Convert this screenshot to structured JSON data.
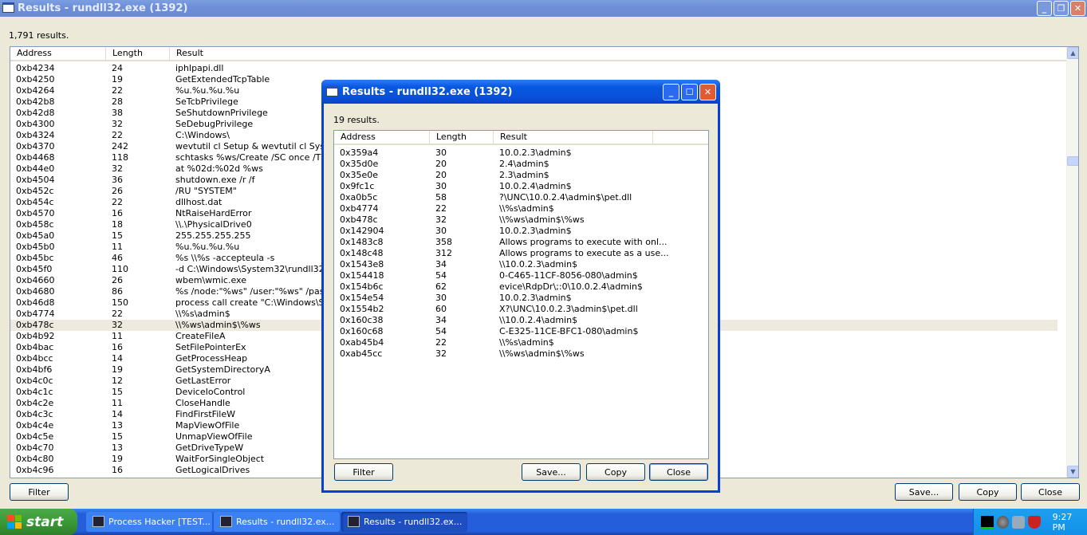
{
  "main": {
    "title": "Results - rundll32.exe (1392)",
    "count": "1,791 results.",
    "columns": [
      "Address",
      "Length",
      "Result"
    ],
    "rows": [
      [
        "0xb4234",
        "24",
        "iphlpapi.dll"
      ],
      [
        "0xb4250",
        "19",
        "GetExtendedTcpTable"
      ],
      [
        "0xb4264",
        "22",
        "%u.%u.%u.%u"
      ],
      [
        "0xb42b8",
        "28",
        "SeTcbPrivilege"
      ],
      [
        "0xb42d8",
        "38",
        "SeShutdownPrivilege"
      ],
      [
        "0xb4300",
        "32",
        "SeDebugPrivilege"
      ],
      [
        "0xb4324",
        "22",
        "C:\\Windows\\"
      ],
      [
        "0xb4370",
        "242",
        "wevtutil cl Setup & wevtutil cl System &"
      ],
      [
        "0xb4468",
        "118",
        "schtasks %ws/Create /SC once /TN \"\""
      ],
      [
        "0xb44e0",
        "32",
        "at %02d:%02d %ws"
      ],
      [
        "0xb4504",
        "36",
        "shutdown.exe /r /f"
      ],
      [
        "0xb452c",
        "26",
        "/RU \"SYSTEM\""
      ],
      [
        "0xb454c",
        "22",
        "dllhost.dat"
      ],
      [
        "0xb4570",
        "16",
        "NtRaiseHardError"
      ],
      [
        "0xb458c",
        "18",
        "\\\\.\\PhysicalDrive0"
      ],
      [
        "0xb45a0",
        "15",
        "255.255.255.255"
      ],
      [
        "0xb45b0",
        "11",
        "%u.%u.%u.%u"
      ],
      [
        "0xb45bc",
        "46",
        "%s \\\\%s -accepteula -s"
      ],
      [
        "0xb45f0",
        "110",
        "-d C:\\Windows\\System32\\rundll32.exe"
      ],
      [
        "0xb4660",
        "26",
        "wbem\\wmic.exe"
      ],
      [
        "0xb4680",
        "86",
        "%s /node:\"%ws\" /user:\"%ws\" /passw"
      ],
      [
        "0xb46d8",
        "150",
        "process call create \"C:\\Windows\\Syste"
      ],
      [
        "0xb4774",
        "22",
        "\\\\%s\\admin$"
      ],
      [
        "0xb478c",
        "32",
        "\\\\%ws\\admin$\\%ws"
      ],
      [
        "0xb4b92",
        "11",
        "CreateFileA"
      ],
      [
        "0xb4bac",
        "16",
        "SetFilePointerEx"
      ],
      [
        "0xb4bcc",
        "14",
        "GetProcessHeap"
      ],
      [
        "0xb4bf6",
        "19",
        "GetSystemDirectoryA"
      ],
      [
        "0xb4c0c",
        "12",
        "GetLastError"
      ],
      [
        "0xb4c1c",
        "15",
        "DeviceIoControl"
      ],
      [
        "0xb4c2e",
        "11",
        "CloseHandle"
      ],
      [
        "0xb4c3c",
        "14",
        "FindFirstFileW"
      ],
      [
        "0xb4c4e",
        "13",
        "MapViewOfFile"
      ],
      [
        "0xb4c5e",
        "15",
        "UnmapViewOfFile"
      ],
      [
        "0xb4c70",
        "13",
        "GetDriveTypeW"
      ],
      [
        "0xb4c80",
        "19",
        "WaitForSingleObject"
      ],
      [
        "0xb4c96",
        "16",
        "GetLogicalDrives"
      ]
    ],
    "selected_row": 23,
    "buttons": {
      "filter": "Filter",
      "save": "Save...",
      "copy": "Copy",
      "close": "Close"
    }
  },
  "dialog": {
    "title": "Results - rundll32.exe (1392)",
    "count": "19 results.",
    "columns": [
      "Address",
      "Length",
      "Result"
    ],
    "rows": [
      [
        "0x359a4",
        "30",
        "10.0.2.3\\admin$"
      ],
      [
        "0x35d0e",
        "20",
        "2.4\\admin$"
      ],
      [
        "0x35e0e",
        "20",
        "2.3\\admin$"
      ],
      [
        "0x9fc1c",
        "30",
        "10.0.2.4\\admin$"
      ],
      [
        "0xa0b5c",
        "58",
        "?\\UNC\\10.0.2.4\\admin$\\pet.dll"
      ],
      [
        "0xb4774",
        "22",
        "\\\\%s\\admin$"
      ],
      [
        "0xb478c",
        "32",
        "\\\\%ws\\admin$\\%ws"
      ],
      [
        "0x142904",
        "30",
        "10.0.2.3\\admin$"
      ],
      [
        "0x1483c8",
        "358",
        "Allows programs to execute with onl..."
      ],
      [
        "0x148c48",
        "312",
        "Allows programs to execute as a use..."
      ],
      [
        "0x1543e8",
        "34",
        "\\\\10.0.2.3\\admin$"
      ],
      [
        "0x154418",
        "54",
        "0-C465-11CF-8056-080\\admin$"
      ],
      [
        "0x154b6c",
        "62",
        "evice\\RdpDr\\;:0\\10.0.2.4\\admin$"
      ],
      [
        "0x154e54",
        "30",
        "10.0.2.3\\admin$"
      ],
      [
        "0x1554b2",
        "60",
        "X?\\UNC\\10.0.2.3\\admin$\\pet.dll"
      ],
      [
        "0x160c38",
        "34",
        "\\\\10.0.2.4\\admin$"
      ],
      [
        "0x160c68",
        "54",
        "C-E325-11CE-BFC1-080\\admin$"
      ],
      [
        "0xab45b4",
        "22",
        "\\\\%s\\admin$"
      ],
      [
        "0xab45cc",
        "32",
        "\\\\%ws\\admin$\\%ws"
      ]
    ],
    "buttons": {
      "filter": "Filter",
      "save": "Save...",
      "copy": "Copy",
      "close": "Close"
    }
  },
  "taskbar": {
    "start": "start",
    "tasks": [
      "Process Hacker [TEST...",
      "Results - rundll32.ex...",
      "Results - rundll32.ex..."
    ],
    "clock": "9:27 PM"
  }
}
